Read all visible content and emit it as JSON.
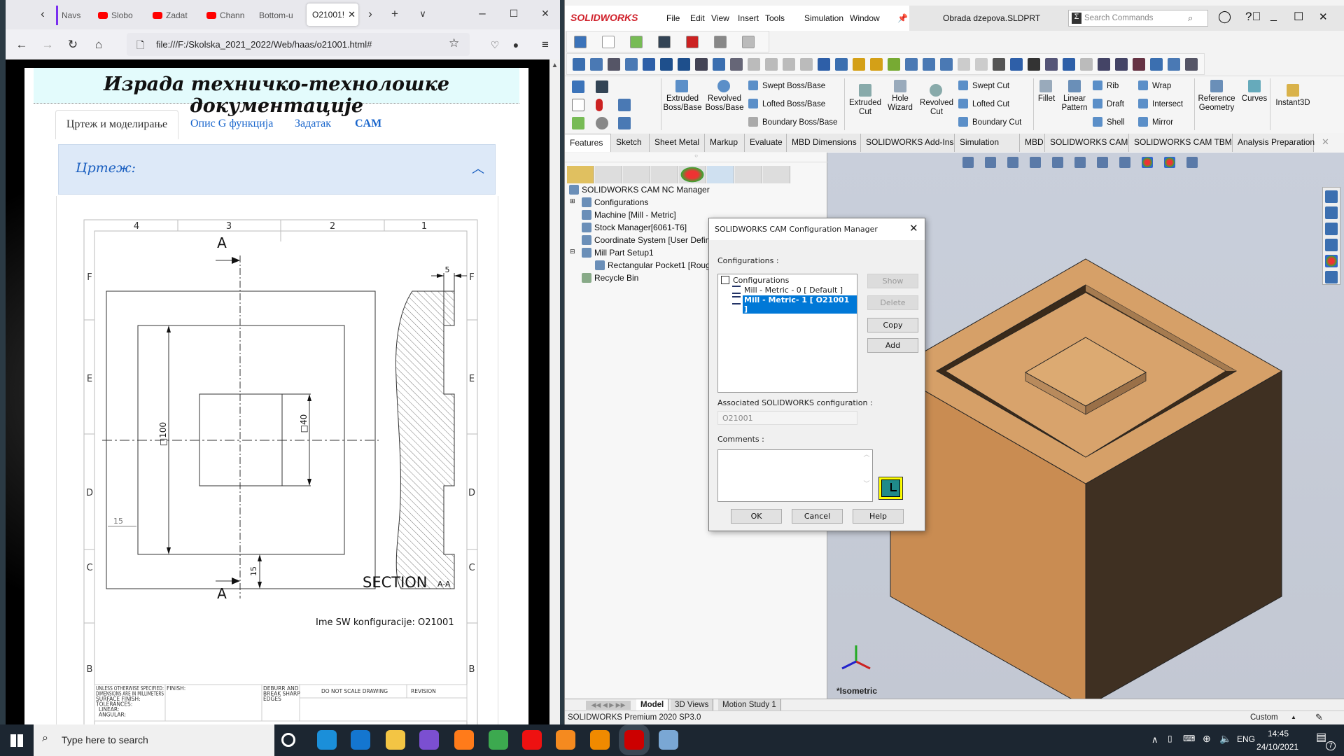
{
  "firefox": {
    "tabs": [
      {
        "label": "Navs",
        "icon": "purple-tab-icon"
      },
      {
        "label": "Slobo",
        "icon": "youtube-icon"
      },
      {
        "label": "Zadat",
        "icon": "youtube-icon"
      },
      {
        "label": "Chann",
        "icon": "youtube-icon"
      },
      {
        "label": "Bottom-u",
        "icon": ""
      }
    ],
    "active_tab": "O21001!",
    "url": "file:///F:/Skolska_2021_2022/Web/haas/o21001.html#",
    "page": {
      "title": "Израда техничко-технолошке документације",
      "tabs": [
        "Цртеж и моделирање",
        "Опис G функција",
        "Задатак",
        "CAM"
      ],
      "active_tab": 0,
      "accordion_title": "Цртеж:",
      "drawing": {
        "columns": [
          "4",
          "3",
          "2",
          "1"
        ],
        "rows": [
          "F",
          "E",
          "D",
          "C",
          "B"
        ],
        "section_letter": "A",
        "dim_outer": "□100",
        "dim_inner": "□40",
        "dim_wall_h": "15",
        "dim_wall_v": "15",
        "dim_depth": "5",
        "section_label": "SECTION",
        "section_id": "A-A",
        "config_note": "Ime SW konfiguracije: O21001",
        "title_block": {
          "general": [
            "UNLESS OTHERWISE SPECIFIED:",
            "DIMENSIONS ARE IN MILLIMETERS",
            "SURFACE FINISH:",
            "TOLERANCES:",
            "LINEAR:",
            "ANGULAR:"
          ],
          "finish": "FINISH:",
          "deburr": [
            "DEBURR AND",
            "BREAK SHARP",
            "EDGES"
          ],
          "no_scale": "DO NOT SCALE DRAWING",
          "revision": "REVISION"
        }
      }
    }
  },
  "solidworks": {
    "brand": "SOLIDWORKS",
    "menu": [
      "File",
      "Edit",
      "View",
      "Insert",
      "Tools",
      "Simulation",
      "Window"
    ],
    "document_title": "Obrada dzepova.SLDPRT",
    "search_placeholder": "Search Commands",
    "cam_toolbar_icons": 36,
    "commands": {
      "extruded_boss": "Extruded Boss/Base",
      "revolved_boss": "Revolved Boss/Base",
      "swept_boss": "Swept Boss/Base",
      "lofted_boss": "Lofted Boss/Base",
      "boundary_boss": "Boundary Boss/Base",
      "extruded_cut": "Extruded Cut",
      "hole_wizard": "Hole Wizard",
      "revolved_cut": "Revolved Cut",
      "swept_cut": "Swept Cut",
      "lofted_cut": "Lofted Cut",
      "boundary_cut": "Boundary Cut",
      "fillet": "Fillet",
      "linear_pattern": "Linear Pattern",
      "rib": "Rib",
      "draft": "Draft",
      "shell": "Shell",
      "wrap": "Wrap",
      "intersect": "Intersect",
      "mirror": "Mirror",
      "reference_geometry": "Reference Geometry",
      "curves": "Curves",
      "instant3d": "Instant3D"
    },
    "tabs": [
      "Features",
      "Sketch",
      "Sheet Metal",
      "Markup",
      "Evaluate",
      "MBD Dimensions",
      "SOLIDWORKS Add-Ins",
      "Simulation",
      "MBD",
      "SOLIDWORKS CAM",
      "SOLIDWORKS CAM TBM",
      "Analysis Preparation"
    ],
    "active_tab": "Features",
    "tree": [
      "SOLIDWORKS CAM NC Manager",
      "Configurations",
      "Machine [Mill - Metric]",
      "Stock Manager[6061-T6]",
      "Coordinate System [User Defin",
      "Mill Part Setup1",
      "Rectangular Pocket1 [Roug",
      "Recycle Bin"
    ],
    "view_name": "*Isometric",
    "bottom_tabs": [
      "Model",
      "3D Views",
      "Motion Study 1"
    ],
    "status": "SOLIDWORKS Premium 2020 SP3.0",
    "units": "Custom",
    "model_colors": {
      "wood_top": "#d6a068",
      "wood_left": "#c98c52",
      "wood_dark": "#3f3022"
    }
  },
  "dialog": {
    "title": "SOLIDWORKS CAM Configuration Manager",
    "configurations_label": "Configurations :",
    "list_root": "Configurations",
    "items": [
      "Mill - Metric - 0 [ Default ]",
      "Mill - Metric- 1 [ O21001 ]"
    ],
    "selected_index": 1,
    "buttons": {
      "show": "Show",
      "delete": "Delete",
      "copy": "Copy",
      "add": "Add",
      "ok": "OK",
      "cancel": "Cancel",
      "help": "Help"
    },
    "associated_label": "Associated SOLIDWORKS configuration :",
    "associated_value": "O21001",
    "comments_label": "Comments :",
    "comments_value": "",
    "selection_color": "#0078d7"
  },
  "taskbar": {
    "search_placeholder": "Type here to search",
    "apps": [
      "cortana",
      "edge",
      "mail",
      "file-explorer",
      "viber",
      "firefox",
      "chrome",
      "opera",
      "media-player",
      "sublime-text",
      "solidworks-2020",
      "paint"
    ],
    "active_app": "solidworks-2020",
    "language": "ENG",
    "time": "14:45",
    "date": "24/10/2021",
    "notifications": "7"
  }
}
